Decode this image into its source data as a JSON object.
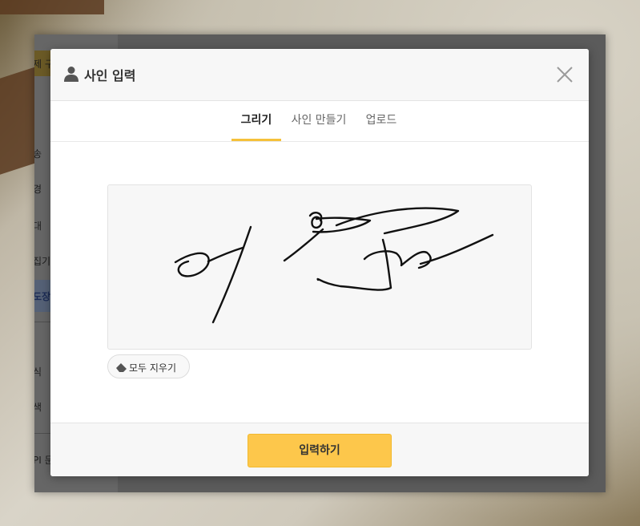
{
  "sidebar": {
    "items": [
      "제 구",
      "송",
      "경",
      "대",
      "집기",
      "도장",
      "식",
      "색",
      "PI 문"
    ]
  },
  "modal": {
    "title": "사인 입력",
    "tabs": [
      {
        "label": "그리기",
        "active": true
      },
      {
        "label": "사인 만들기",
        "active": false
      },
      {
        "label": "업로드",
        "active": false
      }
    ],
    "clear_label": "모두 지우기",
    "submit_label": "입력하기"
  },
  "colors": {
    "accent": "#fdc74b",
    "tab_underline": "#f5c13b"
  }
}
